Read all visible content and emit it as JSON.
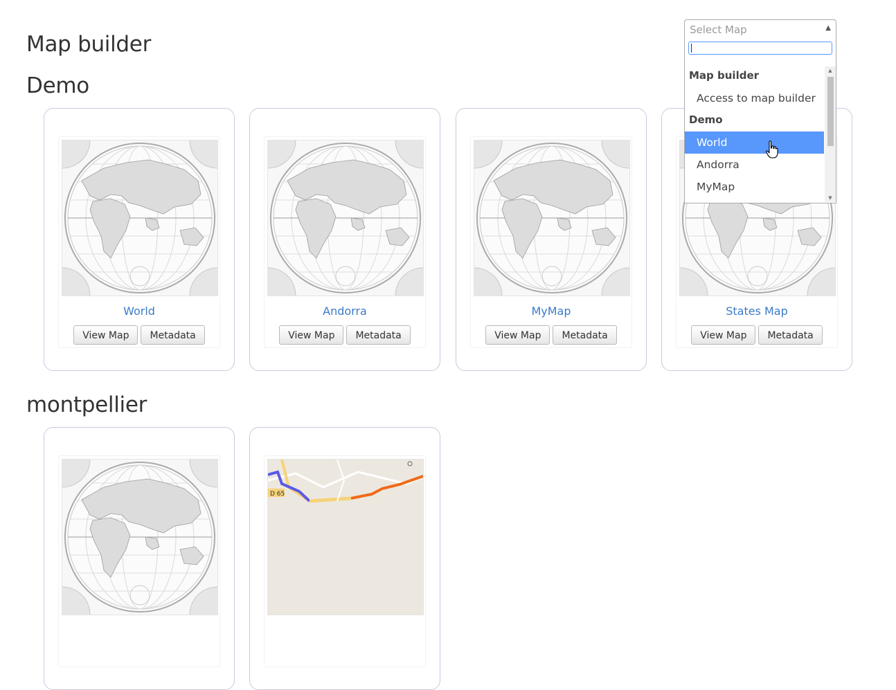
{
  "page": {
    "title": "Map builder"
  },
  "groups": [
    {
      "name": "Demo",
      "maps": [
        {
          "title": "World",
          "view_label": "View Map",
          "meta_label": "Metadata",
          "thumb": "world-map"
        },
        {
          "title": "Andorra",
          "view_label": "View Map",
          "meta_label": "Metadata",
          "thumb": "world-map"
        },
        {
          "title": "MyMap",
          "view_label": "View Map",
          "meta_label": "Metadata",
          "thumb": "world-map"
        },
        {
          "title": "States Map",
          "view_label": "View Map",
          "meta_label": "Metadata",
          "thumb": "world-map"
        }
      ]
    },
    {
      "name": "montpellier",
      "maps": [
        {
          "thumb": "world-map"
        },
        {
          "thumb": "street-map",
          "road_label": "D 65"
        }
      ]
    }
  ],
  "select": {
    "placeholder": "Select Map",
    "search_value": "",
    "options": [
      {
        "group": "Map builder",
        "items": [
          "Access to map builder"
        ]
      },
      {
        "group": "Demo",
        "items": [
          "World",
          "Andorra",
          "MyMap"
        ]
      }
    ],
    "highlighted": "World"
  },
  "colors": {
    "link": "#3a7bc8",
    "highlight": "#5897fb",
    "card_border": "#c9c9e0"
  }
}
